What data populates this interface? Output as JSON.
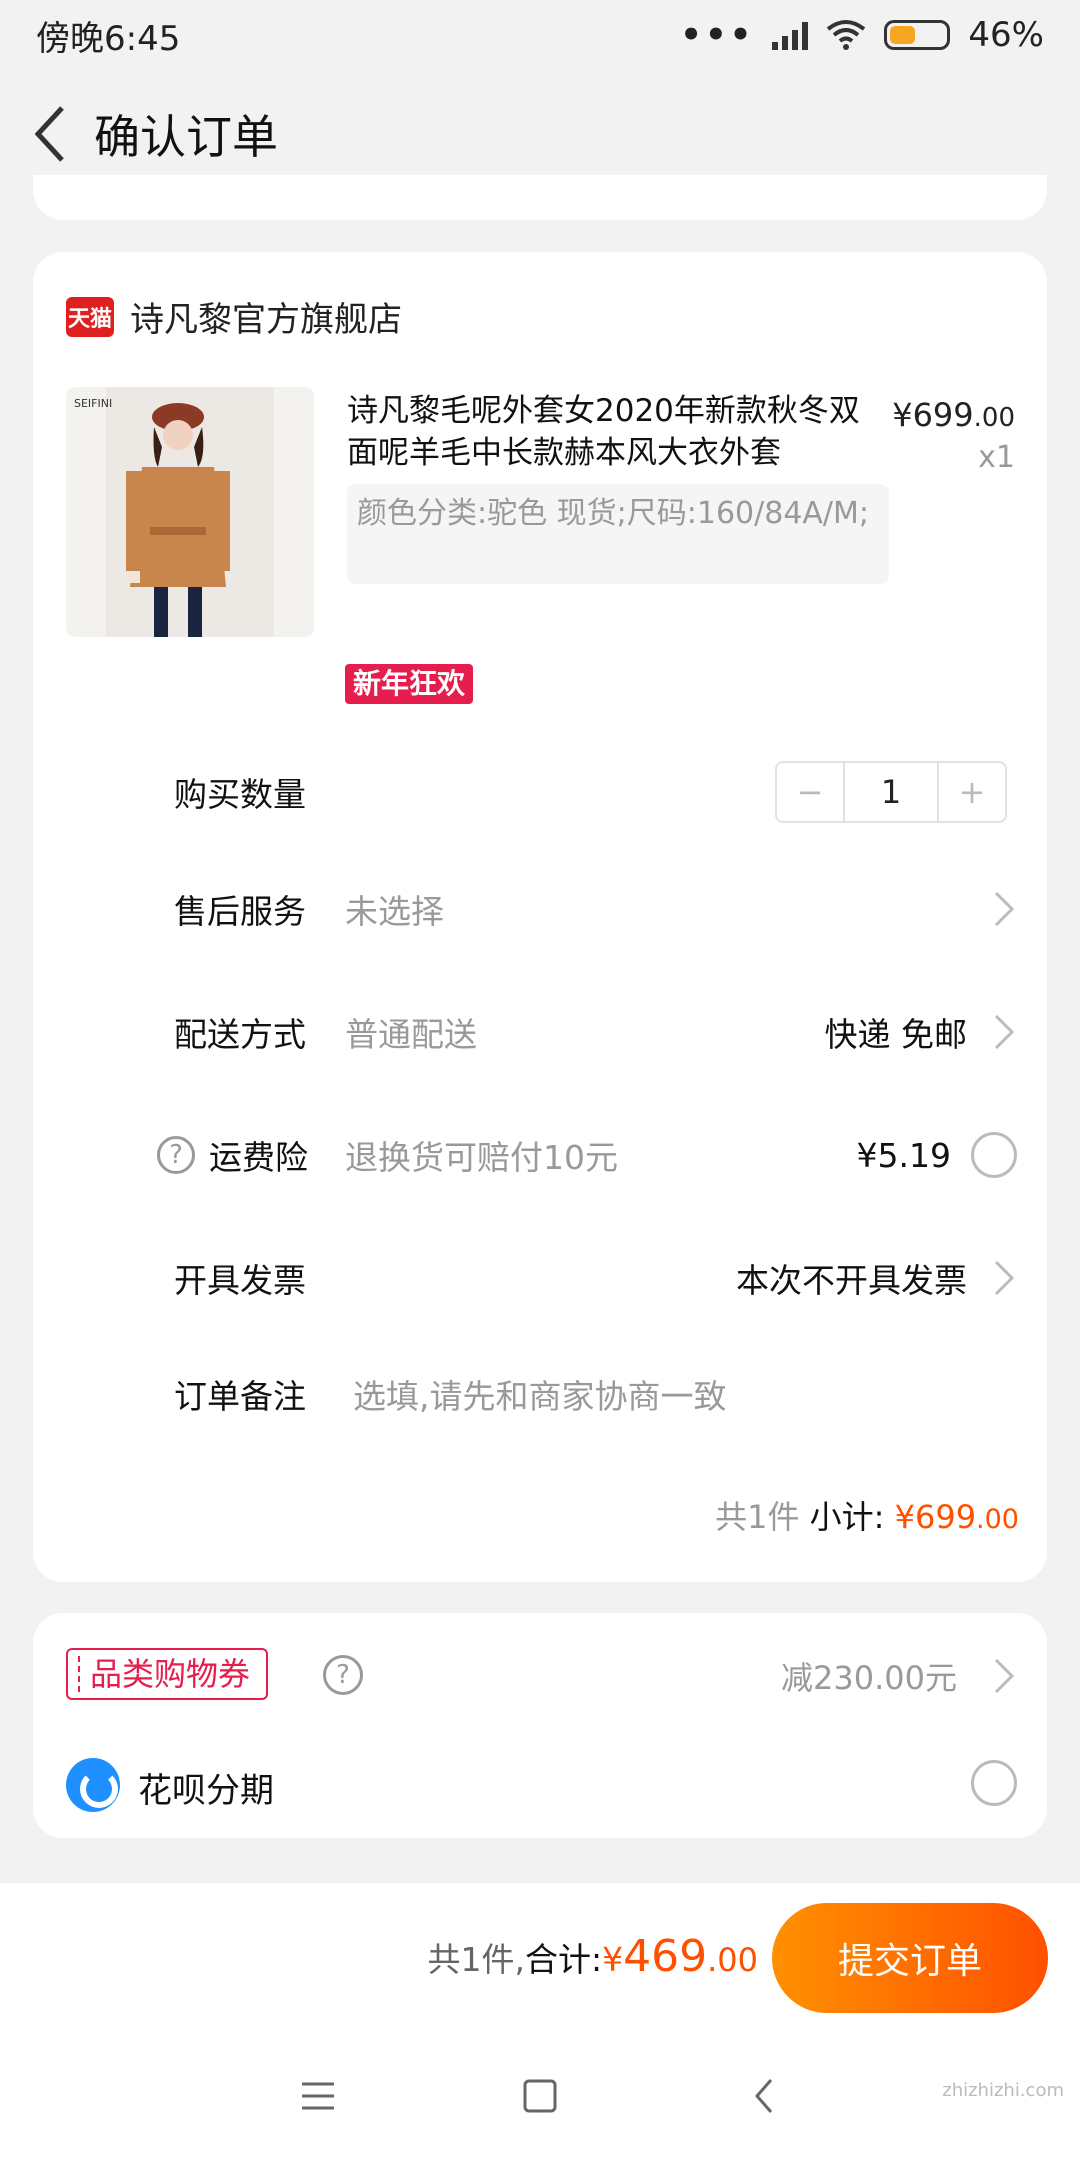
{
  "status_bar": {
    "time": "傍晚6:45",
    "battery": "46%"
  },
  "nav": {
    "title": "确认订单"
  },
  "store": {
    "badge": "天猫",
    "name": "诗凡黎官方旗舰店"
  },
  "product": {
    "image_brand": "SEIFINI",
    "title": "诗凡黎毛呢外套女2020年新款秋冬双面呢羊毛中长款赫本风大衣外套",
    "price_main": "¥699",
    "price_cents": ".00",
    "quantity": "x1",
    "sku": "颜色分类:驼色 现货;尺码:160/84A/M;",
    "promo": "新年狂欢"
  },
  "rows": {
    "quantity_label": "购买数量",
    "quantity_value": "1",
    "minus": "−",
    "plus": "+",
    "aftersale_label": "售后服务",
    "aftersale_value": "未选择",
    "delivery_label": "配送方式",
    "delivery_value": "普通配送",
    "delivery_right": "快递 免邮",
    "insurance_label": "运费险",
    "insurance_value": "退换货可赔付10元",
    "insurance_price": "¥5.19",
    "invoice_label": "开具发票",
    "invoice_right": "本次不开具发票",
    "note_label": "订单备注",
    "note_placeholder": "选填,请先和商家协商一致"
  },
  "subtotal": {
    "count": "共1件",
    "label": "小计:",
    "amount": "¥699",
    "cents": ".00"
  },
  "coupon": {
    "tag": "品类购物券",
    "discount": "减230.00元",
    "huabei": "花呗分期"
  },
  "submit": {
    "count": "共1件,",
    "label": "合计:",
    "currency": "¥",
    "amount": "469",
    "cents": ".00",
    "button": "提交订单"
  },
  "watermark": "zhizhizhi.com"
}
